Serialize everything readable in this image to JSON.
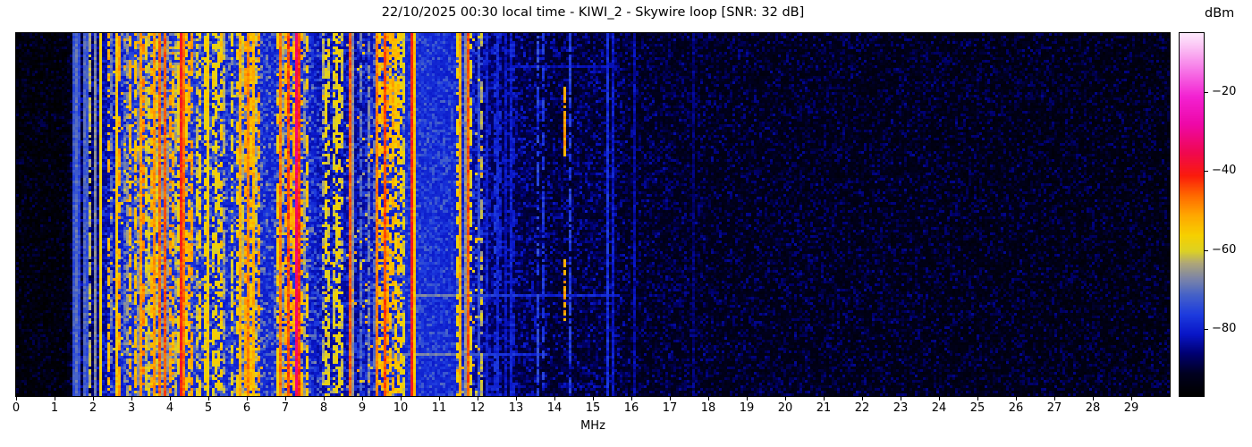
{
  "chart_data": {
    "type": "heatmap",
    "title": "22/10/2025 00:30 local time - KIWI_2 - Skywire loop [SNR: 32 dB]",
    "xlabel": "MHz",
    "x_range_mhz": [
      0,
      30
    ],
    "x_ticks": [
      0,
      1,
      2,
      3,
      4,
      5,
      6,
      7,
      8,
      9,
      10,
      11,
      12,
      13,
      14,
      15,
      16,
      17,
      18,
      19,
      20,
      21,
      22,
      23,
      24,
      25,
      26,
      27,
      28,
      29
    ],
    "y_ticks": [],
    "colorbar": {
      "label": "dBm",
      "tick_values": [
        -20,
        -40,
        -60,
        -80
      ],
      "tick_labels": [
        "−20",
        "−40",
        "−60",
        "−80"
      ],
      "vmin": -96.5,
      "vmax": -5
    },
    "colormap_stops": [
      [
        -96.5,
        "#000000"
      ],
      [
        -91.0,
        "#000020"
      ],
      [
        -86.0,
        "#000070"
      ],
      [
        -81.0,
        "#0916c8"
      ],
      [
        -76.0,
        "#1e3cdf"
      ],
      [
        -71.0,
        "#4763c8"
      ],
      [
        -67.0,
        "#7c85a8"
      ],
      [
        -63.0,
        "#b0a878"
      ],
      [
        -60.0,
        "#ddd224"
      ],
      [
        -56.0,
        "#f7d000"
      ],
      [
        -51.0,
        "#ffa800"
      ],
      [
        -46.0,
        "#ff6a00"
      ],
      [
        -41.0,
        "#fb1c0c"
      ],
      [
        -35.0,
        "#f00852"
      ],
      [
        -28.0,
        "#ee08a8"
      ],
      [
        -21.0,
        "#f322d2"
      ],
      [
        -14.0,
        "#f77ae8"
      ],
      [
        -8.0,
        "#fcc8f6"
      ],
      [
        -5.0,
        "#feeafd"
      ]
    ],
    "noise_floor_profile_mhz_dbm": [
      [
        0.0,
        -95
      ],
      [
        1.3,
        -95
      ],
      [
        1.5,
        -90
      ],
      [
        1.9,
        -89
      ],
      [
        2.1,
        -86
      ],
      [
        2.5,
        -82
      ],
      [
        2.75,
        -80
      ],
      [
        3.05,
        -78
      ],
      [
        4.6,
        -78
      ],
      [
        5.0,
        -80
      ],
      [
        5.6,
        -79
      ],
      [
        6.5,
        -79
      ],
      [
        6.9,
        -79
      ],
      [
        7.6,
        -80
      ],
      [
        8.0,
        -83
      ],
      [
        8.5,
        -83
      ],
      [
        8.8,
        -84
      ],
      [
        9.35,
        -81
      ],
      [
        10.05,
        -79
      ],
      [
        10.35,
        -78
      ],
      [
        11.45,
        -79
      ],
      [
        12.15,
        -86
      ],
      [
        12.6,
        -88
      ],
      [
        13.3,
        -89
      ],
      [
        14.0,
        -90
      ],
      [
        15.0,
        -90
      ],
      [
        16.0,
        -91
      ],
      [
        18.0,
        -92
      ],
      [
        22.0,
        -92.5
      ],
      [
        26.0,
        -93
      ],
      [
        30.0,
        -93.5
      ]
    ],
    "speckle_bands": [
      {
        "start": 0.0,
        "end": 1.45,
        "amp": 8
      },
      {
        "start": 1.45,
        "end": 2.4,
        "amp": 10
      },
      {
        "start": 2.4,
        "end": 3.05,
        "amp": 12
      },
      {
        "start": 3.05,
        "end": 4.65,
        "amp": 16
      },
      {
        "start": 4.65,
        "end": 8.0,
        "amp": 15
      },
      {
        "start": 8.0,
        "end": 9.3,
        "amp": 11
      },
      {
        "start": 9.3,
        "end": 10.1,
        "amp": 15
      },
      {
        "start": 10.1,
        "end": 11.45,
        "amp": 9
      },
      {
        "start": 11.45,
        "end": 12.2,
        "amp": 12
      },
      {
        "start": 12.2,
        "end": 16.0,
        "amp": 10
      },
      {
        "start": 16.0,
        "end": 30.0,
        "amp": 9
      }
    ],
    "busy_bands": [
      {
        "start": 2.45,
        "end": 3.05,
        "lines": 10,
        "lmin": -70,
        "lmax": -52,
        "coverage": 0.6
      },
      {
        "start": 3.05,
        "end": 4.62,
        "lines": 46,
        "lmin": -66,
        "lmax": -48,
        "coverage": 0.7
      },
      {
        "start": 4.65,
        "end": 5.45,
        "lines": 14,
        "lmin": -68,
        "lmax": -54,
        "coverage": 0.6
      },
      {
        "start": 5.55,
        "end": 6.45,
        "lines": 20,
        "lmin": -66,
        "lmax": -50,
        "coverage": 0.7
      },
      {
        "start": 6.75,
        "end": 7.62,
        "lines": 16,
        "lmin": -66,
        "lmax": -50,
        "coverage": 0.7
      },
      {
        "start": 7.95,
        "end": 8.45,
        "lines": 9,
        "lmin": -64,
        "lmax": -55,
        "coverage": 0.45
      },
      {
        "start": 8.55,
        "end": 9.3,
        "lines": 6,
        "lmin": -78,
        "lmax": -68,
        "coverage": 0.5
      },
      {
        "start": 9.35,
        "end": 10.05,
        "lines": 16,
        "lmin": -64,
        "lmax": -50,
        "coverage": 0.7
      },
      {
        "start": 11.45,
        "end": 12.15,
        "lines": 8,
        "lmin": -66,
        "lmax": -52,
        "coverage": 0.55
      },
      {
        "start": 12.2,
        "end": 13.2,
        "lines": 5,
        "lmin": -82,
        "lmax": -76,
        "coverage": 0.7
      }
    ],
    "carriers": [
      {
        "f": 1.5,
        "dbm": -73,
        "style": "s"
      },
      {
        "f": 1.58,
        "dbm": -70,
        "style": "s"
      },
      {
        "f": 1.66,
        "dbm": -74,
        "style": "s"
      },
      {
        "f": 1.76,
        "dbm": -71,
        "style": "s"
      },
      {
        "f": 1.85,
        "dbm": -73,
        "style": "s"
      },
      {
        "f": 1.95,
        "dbm": -62,
        "style": "d"
      },
      {
        "f": 2.08,
        "dbm": -67,
        "style": "s"
      },
      {
        "f": 2.2,
        "dbm": -57,
        "style": "s"
      },
      {
        "f": 2.42,
        "dbm": -53,
        "style": "p"
      },
      {
        "f": 2.6,
        "dbm": -55,
        "style": "s"
      },
      {
        "f": 2.66,
        "dbm": -51,
        "style": "p"
      },
      {
        "f": 3.25,
        "dbm": -50,
        "style": "s"
      },
      {
        "f": 3.33,
        "dbm": -48,
        "style": "p"
      },
      {
        "f": 3.6,
        "dbm": -50,
        "style": "s"
      },
      {
        "f": 3.7,
        "dbm": -46,
        "style": "s"
      },
      {
        "f": 3.9,
        "dbm": -45,
        "style": "s"
      },
      {
        "f": 4.05,
        "dbm": -52,
        "style": "p"
      },
      {
        "f": 4.28,
        "dbm": -41,
        "style": "s"
      },
      {
        "f": 4.35,
        "dbm": -47,
        "style": "s"
      },
      {
        "f": 4.47,
        "dbm": -52,
        "style": "p"
      },
      {
        "f": 5.0,
        "dbm": -56,
        "style": "s"
      },
      {
        "f": 5.1,
        "dbm": -58,
        "style": "p"
      },
      {
        "f": 5.3,
        "dbm": -57,
        "style": "p"
      },
      {
        "f": 5.8,
        "dbm": -52,
        "style": "s"
      },
      {
        "f": 6.0,
        "dbm": -48,
        "style": "s"
      },
      {
        "f": 6.07,
        "dbm": -54,
        "style": "p"
      },
      {
        "f": 6.18,
        "dbm": -52,
        "style": "s"
      },
      {
        "f": 6.28,
        "dbm": -50,
        "style": "p"
      },
      {
        "f": 6.9,
        "dbm": -47,
        "style": "s"
      },
      {
        "f": 7.07,
        "dbm": -44,
        "style": "s"
      },
      {
        "f": 7.2,
        "dbm": -52,
        "style": "p"
      },
      {
        "f": 7.285,
        "dbm": -33,
        "style": "s"
      },
      {
        "f": 7.33,
        "dbm": -43,
        "style": "s"
      },
      {
        "f": 7.42,
        "dbm": -52,
        "style": "p"
      },
      {
        "f": 7.55,
        "dbm": -55,
        "style": "p"
      },
      {
        "f": 8.04,
        "dbm": -58,
        "style": "p"
      },
      {
        "f": 8.13,
        "dbm": -60,
        "style": "p"
      },
      {
        "f": 8.25,
        "dbm": -60,
        "style": "p"
      },
      {
        "f": 8.35,
        "dbm": -58,
        "style": "p"
      },
      {
        "f": 8.66,
        "dbm": -45,
        "style": "s"
      },
      {
        "f": 8.75,
        "dbm": -66,
        "style": "s"
      },
      {
        "f": 8.95,
        "dbm": -70,
        "style": "d"
      },
      {
        "f": 9.2,
        "dbm": -68,
        "style": "d"
      },
      {
        "f": 9.4,
        "dbm": -48,
        "style": "s"
      },
      {
        "f": 9.62,
        "dbm": -44,
        "style": "s"
      },
      {
        "f": 9.72,
        "dbm": -54,
        "style": "p"
      },
      {
        "f": 9.8,
        "dbm": -52,
        "style": "p"
      },
      {
        "f": 9.9,
        "dbm": -55,
        "style": "p"
      },
      {
        "f": 10.0,
        "dbm": -57,
        "style": "p"
      },
      {
        "f": 10.3,
        "dbm": -41,
        "style": "s"
      },
      {
        "f": 11.58,
        "dbm": -52,
        "style": "s"
      },
      {
        "f": 11.7,
        "dbm": -66,
        "style": "s"
      },
      {
        "f": 11.79,
        "dbm": -45,
        "style": "s"
      },
      {
        "f": 11.86,
        "dbm": -58,
        "style": "p"
      },
      {
        "f": 12.02,
        "dbm": -74,
        "style": "s"
      },
      {
        "f": 12.26,
        "dbm": -80,
        "style": "s"
      },
      {
        "f": 12.49,
        "dbm": -79,
        "style": "s"
      },
      {
        "f": 12.74,
        "dbm": -82,
        "style": "s"
      },
      {
        "f": 12.88,
        "dbm": -80,
        "style": "s"
      },
      {
        "f": 13.57,
        "dbm": -75,
        "style": "d"
      },
      {
        "f": 13.68,
        "dbm": -77,
        "style": "d"
      },
      {
        "f": 14.28,
        "dbm": -50,
        "style": "i",
        "bursts": [
          [
            20,
            45
          ],
          [
            83,
            106
          ]
        ]
      },
      {
        "f": 14.38,
        "dbm": -76,
        "style": "d"
      },
      {
        "f": 15.35,
        "dbm": -72,
        "style": "i",
        "bursts": [
          [
            0,
            9
          ]
        ]
      },
      {
        "f": 15.4,
        "dbm": -78,
        "style": "s"
      },
      {
        "f": 15.55,
        "dbm": -81,
        "style": "s"
      },
      {
        "f": 16.1,
        "dbm": -83,
        "style": "s"
      },
      {
        "f": 17.62,
        "dbm": -86,
        "style": "s"
      }
    ],
    "horizontal_streaks": [
      {
        "row": 97,
        "f0": 10.3,
        "f1": 15.7,
        "boost": 9
      },
      {
        "row": 119,
        "f0": 9.5,
        "f1": 13.8,
        "boost": 9
      },
      {
        "row": 12,
        "f0": 12.9,
        "f1": 15.7,
        "boost": 6
      }
    ],
    "render": {
      "cols": 430,
      "rows": 135,
      "seed": 20251022
    }
  }
}
